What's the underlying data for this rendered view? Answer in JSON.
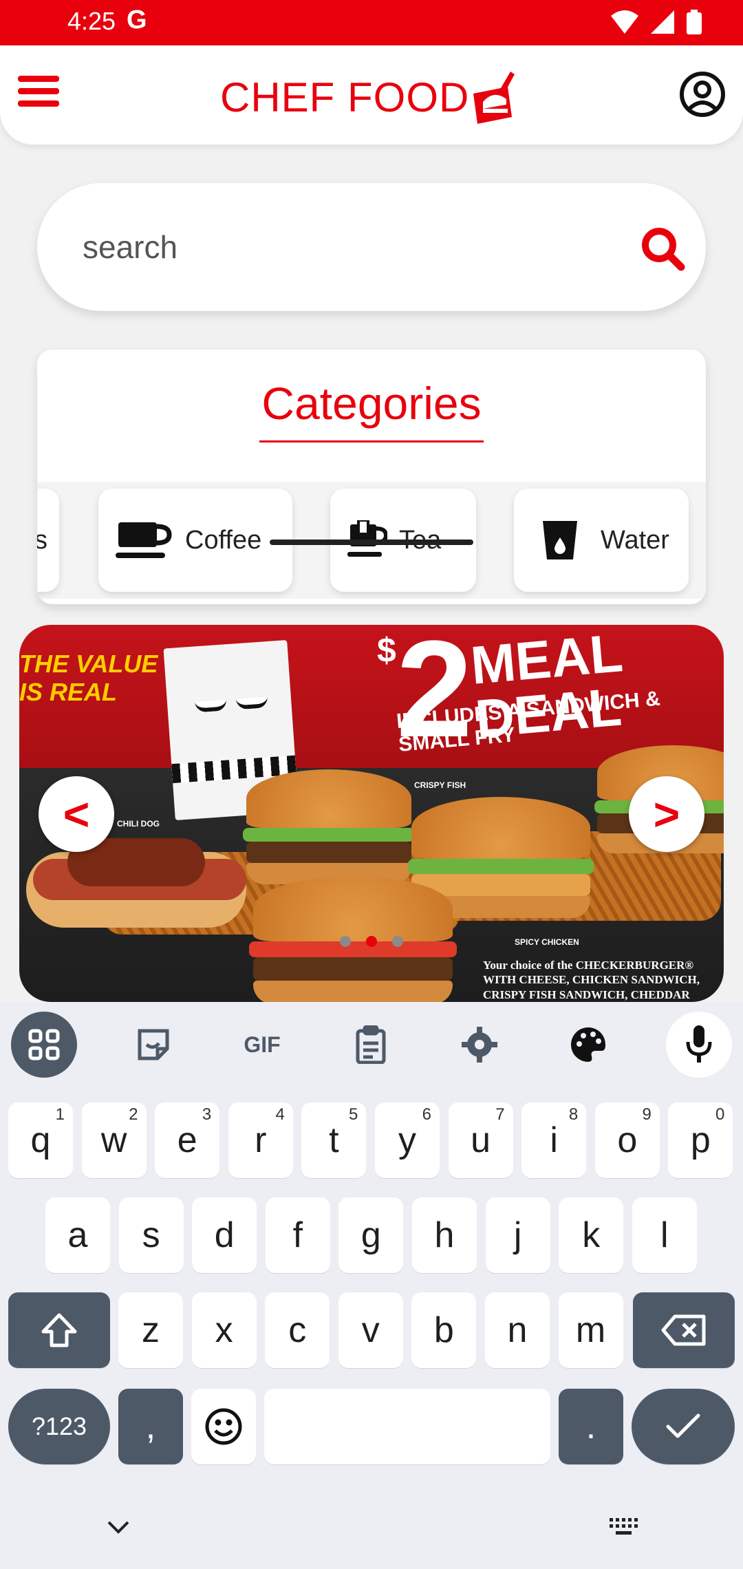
{
  "status_bar": {
    "time": "4:25",
    "carrier": "G"
  },
  "header": {
    "logo_text": "CHEF FOOD"
  },
  "search": {
    "placeholder": "search"
  },
  "categories": {
    "title": "Categories",
    "items": [
      {
        "label": "s",
        "icon": "partial-category-icon"
      },
      {
        "label": "Coffee",
        "icon": "coffee-cup-icon"
      },
      {
        "label": "Tea",
        "icon": "tea-cup-icon"
      },
      {
        "label": "Water",
        "icon": "water-glass-icon"
      }
    ]
  },
  "banner": {
    "tagline_line1": "THE VALUE",
    "tagline_line2": "IS REAL",
    "price_symbol": "$",
    "price": "2",
    "deal_title": "MEAL DEAL",
    "deal_subtitle": "INCLUDES A SANDWICH & SMALL FRY",
    "label_chili_dog": "CHILI DOG",
    "label_crispy_fish": "CRISPY FISH",
    "label_spicy_chicken": "SPICY CHICKEN",
    "fine_print": "Your choice of the CHECKERBURGER® WITH CHEESE, CHICKEN SANDWICH, CRISPY FISH SANDWICH, CHEDDAR CRISP, or CHILI DOG and",
    "prev_label": "<",
    "next_label": ">",
    "slides": 3,
    "active_slide": 2
  },
  "keyboard": {
    "toolbar_gif": "GIF",
    "row1": [
      {
        "k": "q",
        "h": "1"
      },
      {
        "k": "w",
        "h": "2"
      },
      {
        "k": "e",
        "h": "3"
      },
      {
        "k": "r",
        "h": "4"
      },
      {
        "k": "t",
        "h": "5"
      },
      {
        "k": "y",
        "h": "6"
      },
      {
        "k": "u",
        "h": "7"
      },
      {
        "k": "i",
        "h": "8"
      },
      {
        "k": "o",
        "h": "9"
      },
      {
        "k": "p",
        "h": "0"
      }
    ],
    "row2": [
      "a",
      "s",
      "d",
      "f",
      "g",
      "h",
      "j",
      "k",
      "l"
    ],
    "row3": [
      "z",
      "x",
      "c",
      "v",
      "b",
      "n",
      "m"
    ],
    "symbols_key": "?123",
    "comma_key": ",",
    "period_key": "."
  },
  "colors": {
    "brand_red": "#e8000d",
    "key_dark": "#4e5968"
  }
}
